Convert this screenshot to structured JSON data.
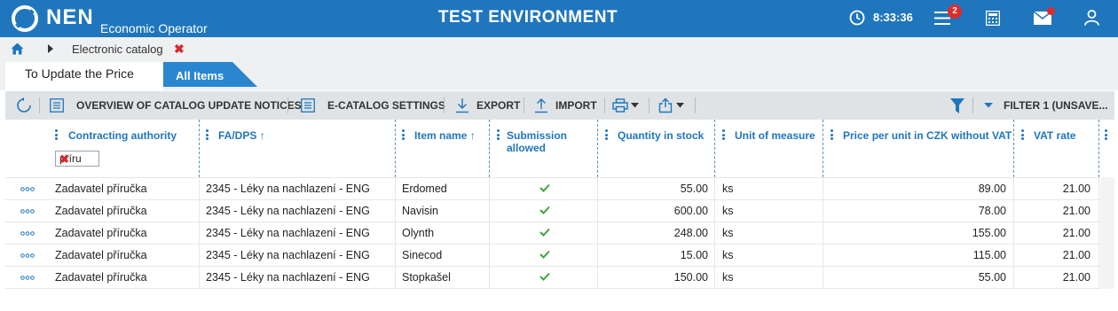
{
  "app": {
    "brand": "NEN",
    "brand_subtitle": "Economic Operator",
    "environment_title": "TEST ENVIRONMENT",
    "clock": "8:33:36",
    "notifications_count": "2",
    "accent_color": "#1f76bd",
    "alert_color": "#e02b2b"
  },
  "breadcrumb": {
    "items": [
      "Electronic catalog"
    ]
  },
  "tabs": [
    {
      "label": "To Update the Price",
      "active": true
    },
    {
      "label": "All Items",
      "active": false
    }
  ],
  "toolbar": {
    "overview_label": "OVERVIEW OF CATALOG UPDATE NOTICES",
    "settings_label": "E-CATALOG SETTINGS",
    "export_label": "EXPORT",
    "import_label": "IMPORT",
    "filter_label": "FILTER 1 (UNSAVE..."
  },
  "table": {
    "columns": [
      "Contracting authority",
      "FA/DPS",
      "Item name",
      "Submission allowed",
      "Quantity in stock",
      "Unit of measure",
      "Price per unit in CZK without VAT",
      "VAT rate"
    ],
    "filter_value": "příru",
    "rows": [
      {
        "authority": "Zadavatel příručka",
        "fa": "2345 - Léky na nachlazení - ENG",
        "item": "Erdomed",
        "allowed": true,
        "qty": "55.00",
        "unit": "ks",
        "price": "89.00",
        "vat": "21.00"
      },
      {
        "authority": "Zadavatel příručka",
        "fa": "2345 - Léky na nachlazení - ENG",
        "item": "Navisin",
        "allowed": true,
        "qty": "600.00",
        "unit": "ks",
        "price": "78.00",
        "vat": "21.00"
      },
      {
        "authority": "Zadavatel příručka",
        "fa": "2345 - Léky na nachlazení - ENG",
        "item": "Olynth",
        "allowed": true,
        "qty": "248.00",
        "unit": "ks",
        "price": "155.00",
        "vat": "21.00"
      },
      {
        "authority": "Zadavatel příručka",
        "fa": "2345 - Léky na nachlazení - ENG",
        "item": "Sinecod",
        "allowed": true,
        "qty": "15.00",
        "unit": "ks",
        "price": "115.00",
        "vat": "21.00"
      },
      {
        "authority": "Zadavatel příručka",
        "fa": "2345 - Léky na nachlazení - ENG",
        "item": "Stopkašel",
        "allowed": true,
        "qty": "150.00",
        "unit": "ks",
        "price": "55.00",
        "vat": "21.00"
      }
    ]
  },
  "icons": {
    "logo": "nen-logo-icon",
    "clock": "clock-icon",
    "menu": "hamburger-menu-icon",
    "calculator": "calculator-icon",
    "mail": "mail-icon",
    "user": "user-icon",
    "home": "home-icon",
    "refresh": "refresh-icon",
    "list": "list-icon",
    "export": "download-icon",
    "import": "upload-icon",
    "print": "print-icon",
    "share": "share-icon",
    "filter": "funnel-icon",
    "check": "check-icon"
  }
}
